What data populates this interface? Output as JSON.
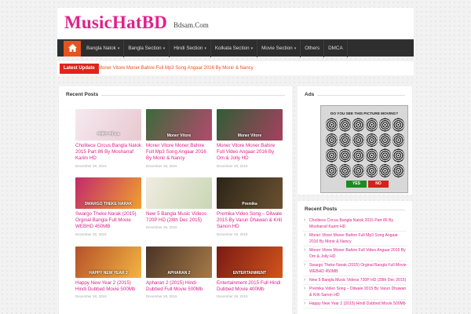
{
  "site": {
    "logo": "MusicHatBD",
    "tagline": "Bdsam.Com"
  },
  "nav": {
    "home_icon": "home-icon",
    "items": [
      {
        "label": "Bangla Natok",
        "caret": "▾"
      },
      {
        "label": "Bangla Section",
        "caret": "▾"
      },
      {
        "label": "Hindi Section",
        "caret": "▾"
      },
      {
        "label": "Kolkata Section",
        "caret": "▾"
      },
      {
        "label": "Movie Section",
        "caret": "▾"
      },
      {
        "label": "Others",
        "caret": ""
      },
      {
        "label": "DMCA",
        "caret": ""
      }
    ]
  },
  "ticker": {
    "label": "Latest Update",
    "text": "Moner Vitore Moner Bahire Full Mp3 Song Angaar 2016 By Monir & Nancy"
  },
  "recent_posts": {
    "title": "Recent Posts",
    "posts": [
      {
        "title": "Cholitece Circus Bangla Natok 2015 Part 86 By Mosharraf Karim HD",
        "date": "December 28, 2015",
        "thumb_text": "সার্কাস পর্ব ৮৬",
        "color_a": "#f6e9ef",
        "color_b": "#e8c9d2"
      },
      {
        "title": "Moner Vitore Moner Bahire Full Mp3 Song Angaar 2016 By Monir & Nancy",
        "date": "December 28, 2015",
        "thumb_text": "Moner Vitore",
        "color_a": "#3c6a3a",
        "color_b": "#b44a6e"
      },
      {
        "title": "Moner Vitore Moner Bahire Full Video Angaar 2016 By Om & Jolly HD",
        "date": "December 28, 2015",
        "thumb_text": "Moner Vitore",
        "color_a": "#2f5e36",
        "color_b": "#a8405f"
      },
      {
        "title": "Swargo Theke Narak (2015) Orginal Bangla Full Movie WEBHD 450MB",
        "date": "December 28, 2015",
        "thumb_text": "SWARGO THEKE NARAK",
        "color_a": "#c22a6a",
        "color_b": "#f0a030"
      },
      {
        "title": "New 5 Bangla Music Videos 720P HD (28th Dec 2015)",
        "date": "December 28, 2015",
        "thumb_text": "",
        "color_a": "#f1ece0",
        "color_b": "#c9d6b5"
      },
      {
        "title": "Premika Video Song – Dilwale 2015 By Varun Dhawan & Kriti Sanon HD",
        "date": "December 28, 2015",
        "thumb_text": "Premika",
        "color_a": "#2b2418",
        "color_b": "#6b5230"
      },
      {
        "title": "Happy New Year 2 (2015) Hindi Dubbed Movie 500Mb",
        "date": "December 28, 2015",
        "thumb_text": "HAPPY NEW YEAR 2",
        "color_a": "#b5512a",
        "color_b": "#f3b541"
      },
      {
        "title": "Apharan 2 (2015) Hindi Dubbed Full Movie 500Mb",
        "date": "December 28, 2015",
        "thumb_text": "APHARAN 2",
        "color_a": "#4a3426",
        "color_b": "#a67a48"
      },
      {
        "title": "Entertainment 2015 Full Hindi Dubbed Movie 400Mb",
        "date": "December 28, 2015",
        "thumb_text": "ENTERTAINMENT",
        "color_a": "#7a1a14",
        "color_b": "#d2551c"
      }
    ]
  },
  "ads": {
    "title": "Ads",
    "question": "DO YOU SEE THIS PICTURE MOVING?",
    "yes": "YES",
    "no": "NO"
  },
  "sidebar_recent": {
    "title": "Recent Posts",
    "items": [
      "Cholitece Circus Bangla Natok 2015 Part 86 By Mosharraf Karim HD",
      "Moner Vitore Moner Bahire Full Mp3 Song Angaar 2016 By Monir & Nancy",
      "Moner Vitore Moner Bahire Full Video Angaar 2016 By Om & Jolly HD",
      "Swargo Theke Narak (2015) Orginal Bangla Full Movie WEBHD 450MB",
      "New 5 Bangla Music Videos 720P HD (28th Dec 2015)",
      "Premika Video Song – Dilwale 2015 By Varun Dhawan & Kriti Sanon HD",
      "Happy New Year 2 (2015) Hindi Dubbed Movie 500Mb"
    ]
  },
  "colors": {
    "brand": "#e0218a",
    "accent": "#e6531d",
    "nav_bg": "#2e2e2e",
    "ticker_label": "#e0241d"
  }
}
